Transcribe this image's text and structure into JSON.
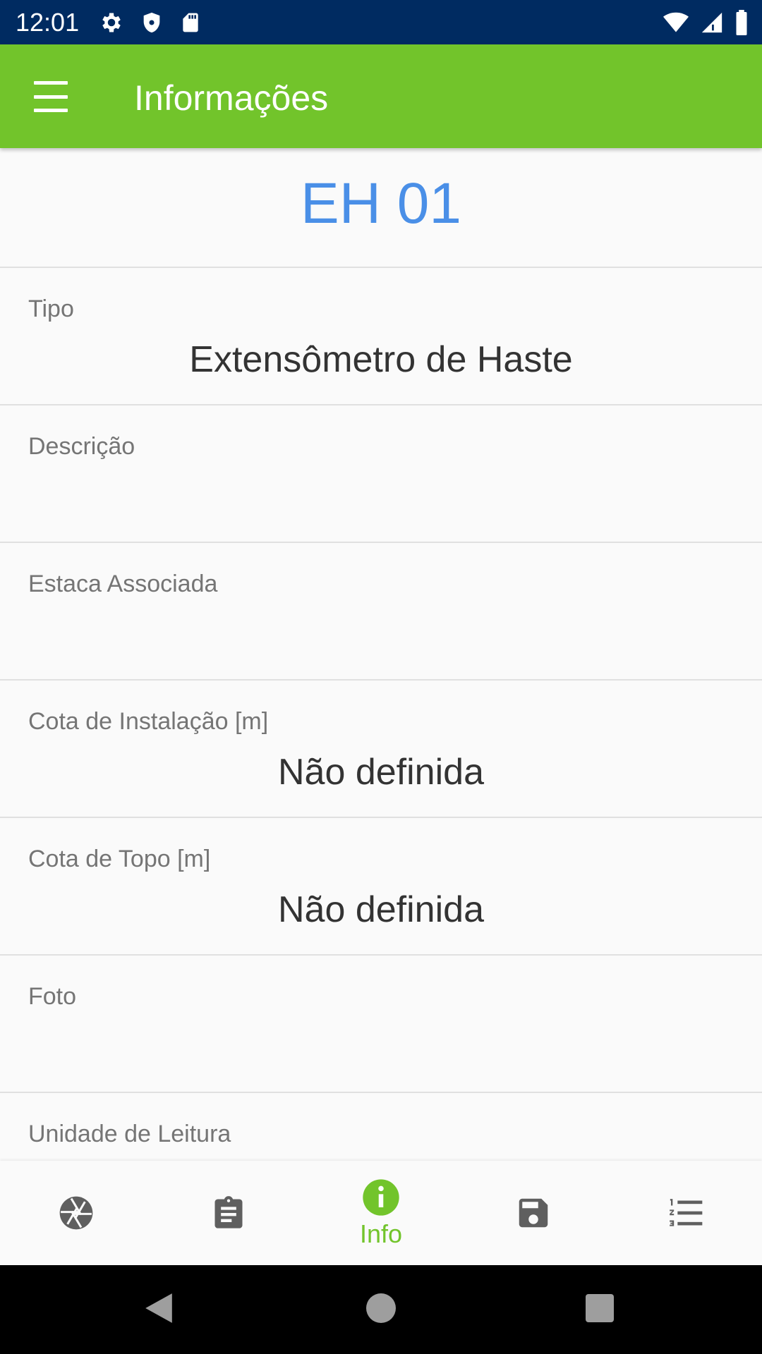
{
  "status_bar": {
    "time": "12:01",
    "left_icons": [
      "gear-icon",
      "shield-icon",
      "sd-card-icon"
    ],
    "right_icons": [
      "wifi-icon",
      "cell-signal-icon",
      "battery-icon"
    ]
  },
  "app_bar": {
    "menu_icon": "menu-icon",
    "title": "Informações"
  },
  "device": {
    "name": "EH 01"
  },
  "fields": [
    {
      "label": "Tipo",
      "value": "Extensômetro de Haste"
    },
    {
      "label": "Descrição",
      "value": ""
    },
    {
      "label": "Estaca Associada",
      "value": ""
    },
    {
      "label": "Cota de Instalação [m]",
      "value": "Não definida"
    },
    {
      "label": "Cota de Topo [m]",
      "value": "Não definida"
    },
    {
      "label": "Foto",
      "value": ""
    },
    {
      "label": "Unidade de Leitura",
      "value": ""
    }
  ],
  "bottom_nav": {
    "items": [
      {
        "icon": "camera-shutter-icon",
        "label": "",
        "active": false
      },
      {
        "icon": "clipboard-icon",
        "label": "",
        "active": false
      },
      {
        "icon": "info-icon",
        "label": "Info",
        "active": true
      },
      {
        "icon": "save-icon",
        "label": "",
        "active": false
      },
      {
        "icon": "numbered-list-icon",
        "label": "",
        "active": false
      }
    ]
  },
  "system_nav": [
    "back-icon",
    "home-icon",
    "recents-icon"
  ],
  "colors": {
    "status_bar": "#002b61",
    "app_bar": "#72c42b",
    "accent_blue": "#4a8fe7",
    "active_nav": "#72c42b",
    "inactive_nav": "#5f5f5f"
  }
}
